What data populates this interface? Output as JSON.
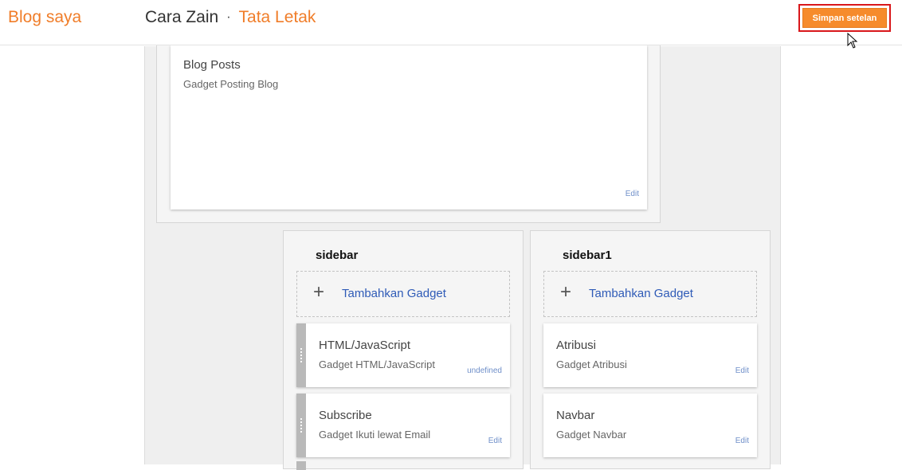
{
  "header": {
    "brand": "Blog saya",
    "blog_name": "Cara Zain",
    "separator": "·",
    "section": "Tata Letak",
    "save_label": "Simpan setelan"
  },
  "main": {
    "posts_gadget": {
      "title": "Blog Posts",
      "subtitle": "Gadget Posting Blog",
      "edit": "Edit"
    }
  },
  "sidebars": [
    {
      "title": "sidebar",
      "add_label": "Tambahkan Gadget",
      "gadgets": [
        {
          "title": "HTML/JavaScript",
          "subtitle": "Gadget HTML/JavaScript",
          "action": "undefined"
        },
        {
          "title": "Subscribe",
          "subtitle": "Gadget Ikuti lewat Email",
          "action": "Edit"
        }
      ]
    },
    {
      "title": "sidebar1",
      "add_label": "Tambahkan Gadget",
      "gadgets": [
        {
          "title": "Atribusi",
          "subtitle": "Gadget Atribusi",
          "action": "Edit"
        },
        {
          "title": "Navbar",
          "subtitle": "Gadget Navbar",
          "action": "Edit"
        }
      ]
    }
  ],
  "colors": {
    "brand_orange": "#f07d29",
    "button_orange": "#f68b2c",
    "highlight_red": "#d9171b",
    "link_blue": "#2f5bb7",
    "edit_blue": "#6f8fc9"
  },
  "icons": {
    "add": "plus-icon",
    "pointer": "mouse-cursor-icon",
    "drag": "drag-handle-icon"
  }
}
